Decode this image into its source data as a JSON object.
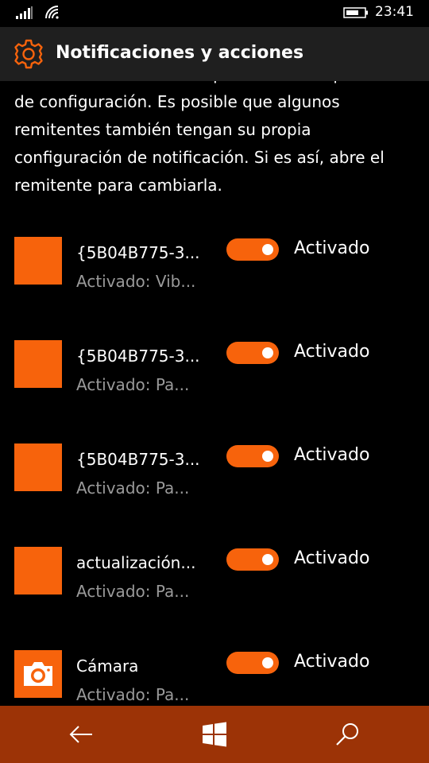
{
  "status_bar": {
    "time": "23:41",
    "icons": [
      "signal-bars-icon",
      "wifi-icon",
      "battery-icon"
    ]
  },
  "header": {
    "icon": "gear-icon",
    "title": "Notificaciones y acciones"
  },
  "description": "Seleccione un remitente para ver más opciones de configuración. Es posible que algunos remitentes también tengan su propia configuración de notificación. Si es así, abre el remitente para cambiarla.",
  "senders": [
    {
      "name": "{5B04B775-3...",
      "status": "Activado: Vib...",
      "toggle_label": "Activado",
      "toggle_on": true,
      "icon": "orange-tile"
    },
    {
      "name": "{5B04B775-3...",
      "status": "Activado: Pa...",
      "toggle_label": "Activado",
      "toggle_on": true,
      "icon": "orange-tile"
    },
    {
      "name": "{5B04B775-3...",
      "status": "Activado: Pa...",
      "toggle_label": "Activado",
      "toggle_on": true,
      "icon": "orange-tile"
    },
    {
      "name": "actualización...",
      "status": "Activado: Pa...",
      "toggle_label": "Activado",
      "toggle_on": true,
      "icon": "orange-tile"
    },
    {
      "name": "Cámara",
      "status": "Activado: Pa...",
      "toggle_label": "Activado",
      "toggle_on": true,
      "icon": "camera-icon"
    }
  ],
  "nav_bar": {
    "buttons": [
      "back-arrow-icon",
      "windows-logo-icon",
      "search-icon"
    ]
  },
  "colors": {
    "accent": "#f7630c",
    "header_bg": "#1f1f1f",
    "nav_bg": "#9c3306",
    "secondary_text": "#9a9a9a"
  }
}
